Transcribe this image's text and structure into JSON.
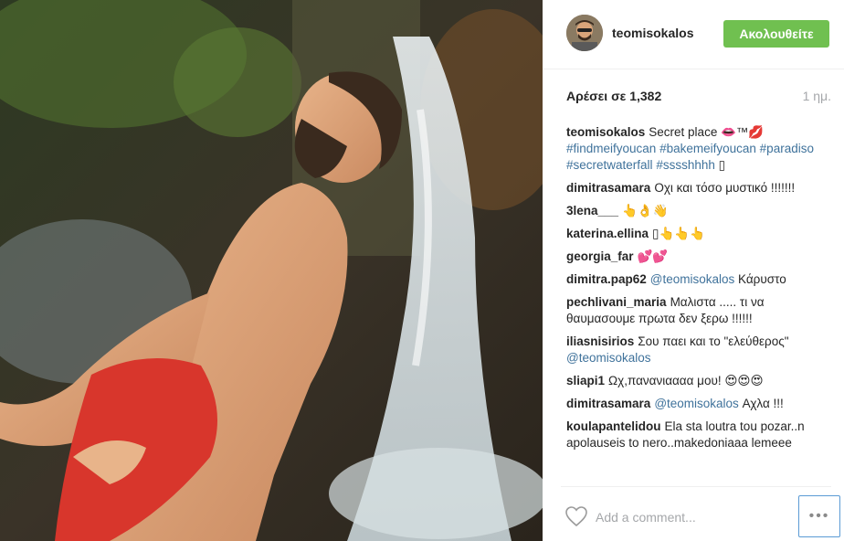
{
  "post": {
    "username": "teomisokalos",
    "follow_label": "Ακολουθείτε",
    "likes": "Αρέσει σε 1,382",
    "time_ago": "1 ημ."
  },
  "comments": [
    {
      "user": "teomisokalos",
      "segments": [
        {
          "t": "Secret place 👄™💋 "
        },
        {
          "t": "#findmeifyoucan",
          "tag": true
        },
        {
          "t": " "
        },
        {
          "t": "#bakemeifyoucan",
          "tag": true
        },
        {
          "t": " "
        },
        {
          "t": "#paradiso",
          "tag": true
        },
        {
          "t": " "
        },
        {
          "t": "#secretwaterfall",
          "tag": true
        },
        {
          "t": " "
        },
        {
          "t": "#sssshhhh",
          "tag": true
        },
        {
          "t": " ▯"
        }
      ]
    },
    {
      "user": "dimitrasamara",
      "segments": [
        {
          "t": "Οχι και τόσο μυστικό !!!!!!!"
        }
      ]
    },
    {
      "user": "3lena___",
      "segments": [
        {
          "t": "👆👌👋"
        }
      ]
    },
    {
      "user": "katerina.ellina",
      "segments": [
        {
          "t": "▯👆👆👆"
        }
      ]
    },
    {
      "user": "georgia_far",
      "segments": [
        {
          "t": "💕💕"
        }
      ]
    },
    {
      "user": "dimitra.pap62",
      "segments": [
        {
          "t": "@teomisokalos",
          "tag": true
        },
        {
          "t": " Κάρυστο"
        }
      ]
    },
    {
      "user": "pechlivani_maria",
      "segments": [
        {
          "t": "Μαλιστα ..... τι να θαυμασουμε πρωτα δεν ξερω !!!!!!"
        }
      ]
    },
    {
      "user": "iliasnisirios",
      "segments": [
        {
          "t": "Σου παει και το \"ελεύθερος\" "
        },
        {
          "t": "@teomisokalos",
          "tag": true
        }
      ]
    },
    {
      "user": "sliapi1",
      "segments": [
        {
          "t": "Ωχ,πανανιαααα μου! 😍😍😍"
        }
      ]
    },
    {
      "user": "dimitrasamara",
      "segments": [
        {
          "t": "@teomisokalos",
          "tag": true
        },
        {
          "t": " Αχλα !!!"
        }
      ]
    },
    {
      "user": "koulapantelidou",
      "segments": [
        {
          "t": "Ela sta loutra tou pozar..n apolauseis to nero..makedoniaaa lemeee"
        }
      ]
    }
  ],
  "footer": {
    "add_comment_placeholder": "Add a comment...",
    "more_label": "•••"
  },
  "colors": {
    "follow_green": "#70c050",
    "link_blue": "#3f729b",
    "muted": "#a5a7aa"
  }
}
